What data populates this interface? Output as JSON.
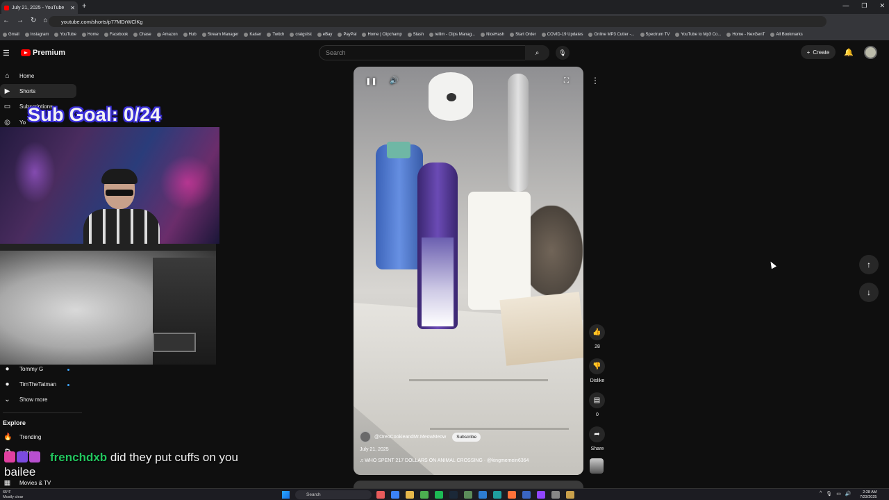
{
  "browser": {
    "tab_title": "July 21, 2025 - YouTube",
    "url": "youtube.com/shorts/p77MDrWClKg",
    "bookmarks": [
      "Gmail",
      "Instagram",
      "YouTube",
      "Home",
      "Facebook",
      "Chase",
      "Amazon",
      "Hub",
      "Stream Manager",
      "Kaiser",
      "Twitch",
      "craigslist",
      "eBay",
      "PayPal",
      "Home | Clipchamp",
      "Stash",
      "rellim - Clips Manag...",
      "NiceHash",
      "Start Order",
      "COVID-19 Updates",
      "Online MP3 Cutter -...",
      "Spectrum TV",
      "YouTube to Mp3 Co...",
      "Home - NexGenT",
      "All Bookmarks"
    ]
  },
  "header": {
    "logo_text": "Premium",
    "search_placeholder": "Search",
    "create_label": "Create"
  },
  "sidebar": {
    "items": [
      {
        "label": "Home",
        "icon": "home-icon"
      },
      {
        "label": "Shorts",
        "icon": "shorts-icon"
      },
      {
        "label": "Subscriptions",
        "icon": "subscriptions-icon"
      },
      {
        "label": "Yo",
        "icon": "you-icon"
      }
    ],
    "channels": [
      {
        "label": "Tommy G"
      },
      {
        "label": "TimTheTatman"
      }
    ],
    "show_more": "Show more",
    "explore_heading": "Explore",
    "explore_items": [
      {
        "label": "Trending"
      },
      {
        "label": "pping"
      },
      {
        "label": "Movies & TV"
      }
    ]
  },
  "overlay": {
    "sub_goal": "Sub Goal: 0/24",
    "chat_user": "frenchdxb",
    "chat_message": "did they put cuffs on you bailee"
  },
  "video": {
    "channel_handle": "@OreoCookieandMr.MeowMeow",
    "subscribe_label": "Subscribe",
    "date": "July 21, 2025",
    "title": "WHO SPENT 217 DOLLARS ON ANIMAL CROSSING · @kingmemein6364"
  },
  "actions": {
    "like_count": "28",
    "dislike_label": "Dislike",
    "comment_count": "0",
    "share_label": "Share"
  },
  "taskbar": {
    "temp": "65°F",
    "weather": "Mostly clear",
    "search_label": "Search",
    "time": "2:28 AM",
    "date": "7/23/2025"
  }
}
